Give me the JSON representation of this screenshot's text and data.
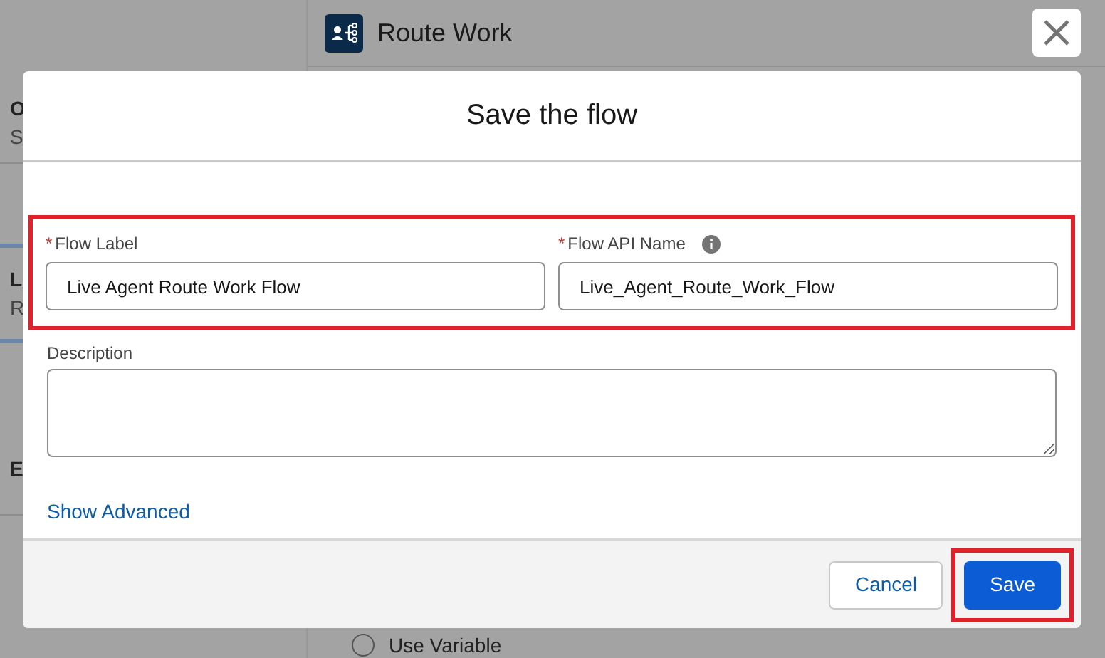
{
  "background": {
    "header_title": "Route Work",
    "left_items": [
      {
        "title": "O",
        "subtitle": "S",
        "selected": false
      },
      {
        "title": "L",
        "subtitle": "R",
        "selected": true
      },
      {
        "title": "E",
        "selected": false
      }
    ],
    "radio_option": {
      "label": "Use Variable",
      "selected": false
    }
  },
  "modal": {
    "title": "Save the flow",
    "fields_highlighted": true,
    "fields": [
      {
        "marker": "*",
        "label": "Flow Label",
        "value": "Live Agent Route Work Flow",
        "info": false
      },
      {
        "marker": "*",
        "label": "Flow API Name",
        "value": "Live_Agent_Route_Work_Flow",
        "info": true
      }
    ],
    "description": {
      "label": "Description"
    },
    "link": "Show Advanced",
    "buttons": [
      {
        "label": "Cancel",
        "kind": "neutral",
        "highlighted": false
      },
      {
        "label": "Save",
        "kind": "brand",
        "highlighted": true
      }
    ]
  }
}
